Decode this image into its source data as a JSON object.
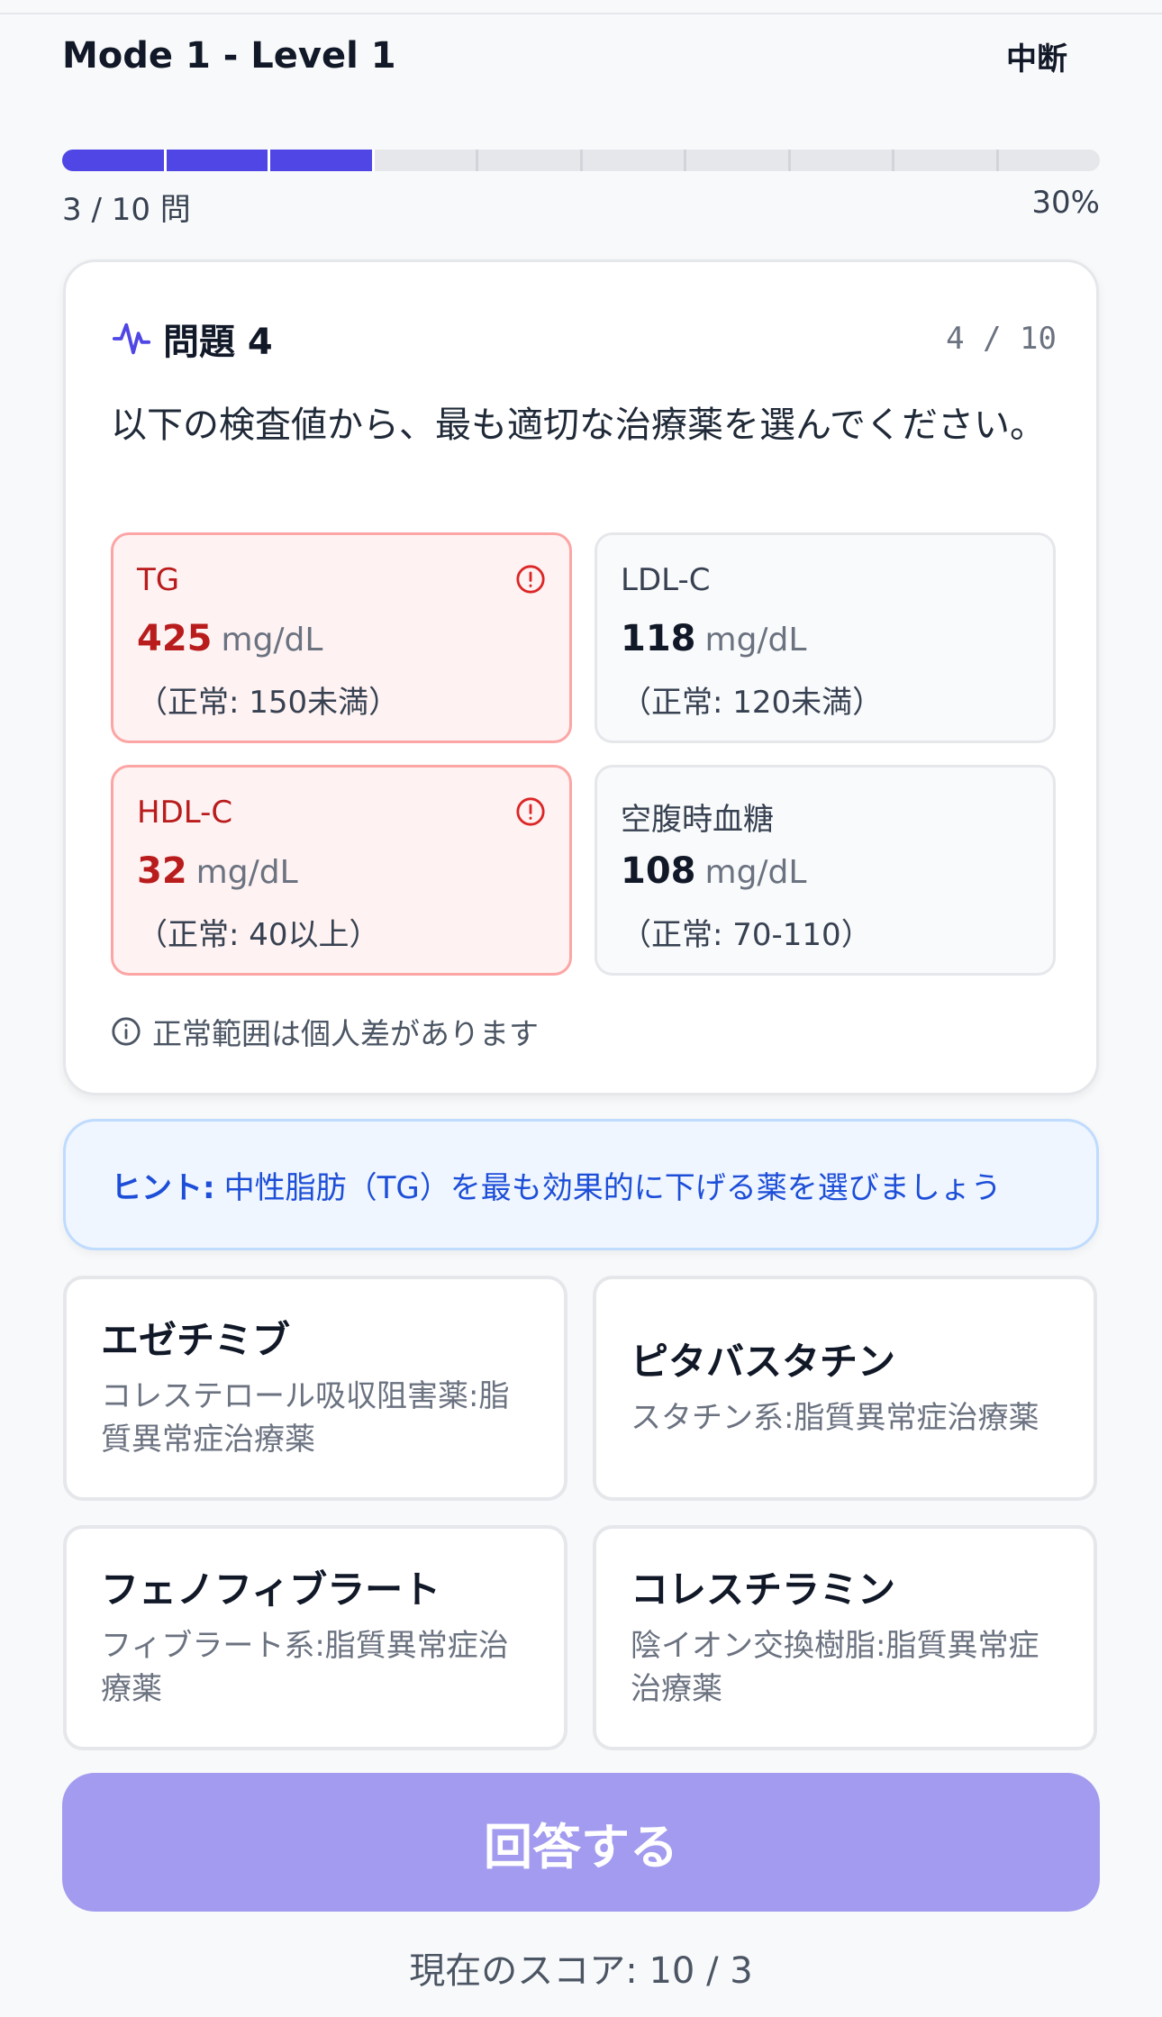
{
  "header": {
    "title": "Mode 1 - Level 1",
    "abort_label": "中断"
  },
  "progress": {
    "answered_label": "3 / 10 問",
    "percent_label": "30%",
    "completed": 3,
    "total": 10
  },
  "question": {
    "title": "問題 4",
    "counter": "4 / 10",
    "text": "以下の検査値から、最も適切な治療薬を選んでください。",
    "labs": [
      {
        "name": "TG",
        "value": "425",
        "unit": "mg/dL",
        "normal": "（正常: 150未満）",
        "abnormal": true
      },
      {
        "name": "LDL-C",
        "value": "118",
        "unit": "mg/dL",
        "normal": "（正常: 120未満）",
        "abnormal": false
      },
      {
        "name": "HDL-C",
        "value": "32",
        "unit": "mg/dL",
        "normal": "（正常: 40以上）",
        "abnormal": true
      },
      {
        "name": "空腹時血糖",
        "value": "108",
        "unit": "mg/dL",
        "normal": "（正常: 70-110）",
        "abnormal": false
      }
    ],
    "note": "正常範囲は個人差があります"
  },
  "hint": {
    "label": "ヒント:",
    "text": "中性脂肪（TG）を最も効果的に下げる薬を選びましょう"
  },
  "options": [
    {
      "name": "エゼチミブ",
      "desc": "コレステロール吸収阻害薬:脂質異常症治療薬"
    },
    {
      "name": "ピタバスタチン",
      "desc": "スタチン系:脂質異常症治療薬"
    },
    {
      "name": "フェノフィブラート",
      "desc": "フィブラート系:脂質異常症治療薬"
    },
    {
      "name": "コレスチラミン",
      "desc": "陰イオン交換樹脂:脂質異常症治療薬"
    }
  ],
  "submit_label": "回答する",
  "score_label": "現在のスコア: 10 / 3",
  "colors": {
    "accent": "#4f46e5",
    "abnormal": "#b91c1c",
    "hint": "#1d4ed8",
    "submit_disabled": "#a29bef"
  }
}
